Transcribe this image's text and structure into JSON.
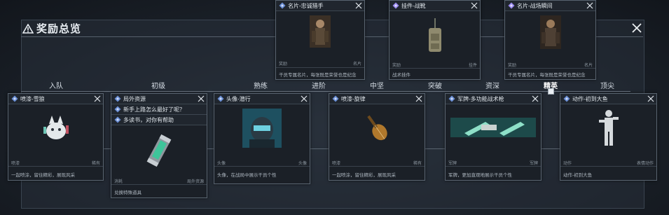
{
  "title": "奖励总览",
  "stages": [
    "入队",
    "初级",
    "熟练",
    "进阶",
    "中坚",
    "突破",
    "资深",
    "精英",
    "顶尖"
  ],
  "active_stage": "精英",
  "colors": {
    "accent": "#6b8fd6",
    "badge": "#9b8cf0",
    "background": "#151a21",
    "card": "#1b2027"
  },
  "top_cards": [
    {
      "name": "名片-忠诚猎手",
      "icon": "diamond-blue-icon",
      "meta_left": "奖励",
      "meta_right": "名片",
      "desc": "干员专属名片，每张既是荣誉也是纪念"
    },
    {
      "name": "挂件-战靴",
      "icon": "diamond-purple-icon",
      "meta_left": "奖励",
      "meta_right": "挂件",
      "desc": "战术挂件"
    },
    {
      "name": "名片-战场瞬间",
      "icon": "diamond-purple-icon",
      "meta_left": "奖励",
      "meta_right": "名片",
      "desc": "干员专属名片，每张既是荣誉也是纪念"
    }
  ],
  "bottom_cards": [
    {
      "name": "喷漆-雪狼",
      "icon": "diamond-blue-icon",
      "meta_left": "喷漆",
      "meta_right": "稀有",
      "desc": "一起喷涂，留住精彩，展现风采"
    },
    {
      "name": "局外资源",
      "icon": "diamond-blue-icon",
      "sub": [
        "新手上路怎么最好了呢？",
        "多读书，对你有帮助"
      ],
      "meta_left": "消耗",
      "meta_right": "局外资源",
      "desc": "兑换特殊道具"
    },
    {
      "name": "头像-潜行",
      "icon": "diamond-blue-icon",
      "meta_left": "头像",
      "meta_right": "头像",
      "desc": "头像，在战局中展示干员个性"
    },
    {
      "name": "喷漆-旋律",
      "icon": "diamond-blue-icon",
      "meta_left": "喷漆",
      "meta_right": "稀有",
      "desc": "一起喷涂，留住精彩，展现风采"
    },
    {
      "name": "军牌-多功能战术枪",
      "icon": "diamond-blue-icon",
      "meta_left": "军牌",
      "meta_right": "军牌",
      "desc": "军牌，更加直观地展示干员个性"
    },
    {
      "name": "动作-初到大鱼",
      "icon": "diamond-blue-icon",
      "meta_left": "动作",
      "meta_right": "表情动作",
      "desc": "动作-初到大鱼"
    }
  ]
}
